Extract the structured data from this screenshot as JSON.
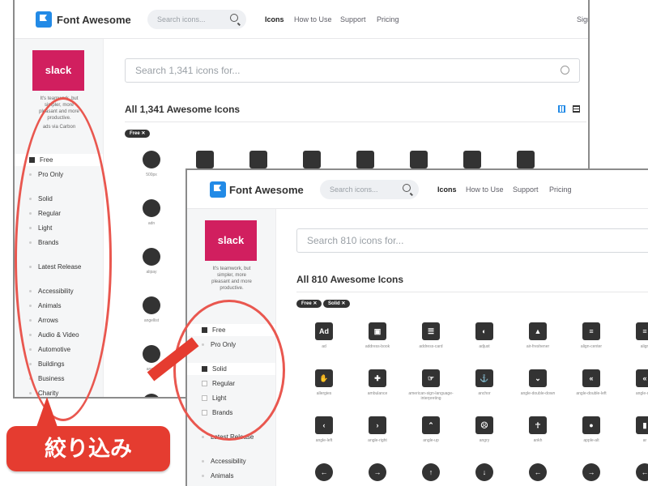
{
  "back": {
    "logo_text": "Font Awesome",
    "search_placeholder": "Search icons...",
    "nav": [
      "Icons",
      "How to Use",
      "Support",
      "Pricing"
    ],
    "signin": "Sign",
    "ad_brand": "slack",
    "ad_lines": [
      "It's teamwork, but",
      "simpler, more",
      "pleasant and more",
      "productive."
    ],
    "ad_via": "ads via Carbon",
    "big_search": "Search 1,341 icons for...",
    "heading": "All 1,341 Awesome Icons",
    "tag": "Free",
    "filters": [
      {
        "label": "Free",
        "mark": "check"
      },
      {
        "label": "Pro Only",
        "mark": "dot"
      },
      {
        "label": "Solid",
        "mark": "dot"
      },
      {
        "label": "Regular",
        "mark": "dot"
      },
      {
        "label": "Light",
        "mark": "dot"
      },
      {
        "label": "Brands",
        "mark": "dot"
      },
      {
        "label": "Latest Release",
        "mark": "dot"
      },
      {
        "label": "Accessibility",
        "mark": "dot"
      },
      {
        "label": "Animals",
        "mark": "dot"
      },
      {
        "label": "Arrows",
        "mark": "dot"
      },
      {
        "label": "Audio & Video",
        "mark": "dot"
      },
      {
        "label": "Automotive",
        "mark": "dot"
      },
      {
        "label": "Buildings",
        "mark": "dot"
      },
      {
        "label": "Business",
        "mark": "dot"
      },
      {
        "label": "Charity",
        "mark": "dot"
      }
    ],
    "icons_col1": [
      "500px",
      "adn",
      "alipay",
      "angellist",
      "angry",
      ""
    ],
    "icons_row1": [
      "",
      "",
      "",
      "",
      "",
      "",
      ""
    ]
  },
  "front": {
    "logo_text": "Font Awesome",
    "search_placeholder": "Search icons...",
    "nav": [
      "Icons",
      "How to Use",
      "Support",
      "Pricing"
    ],
    "ad_brand": "slack",
    "ad_lines": [
      "It's teamwork, but",
      "simpler, more",
      "pleasant and more",
      "productive."
    ],
    "big_search": "Search 810 icons for...",
    "heading": "All 810 Awesome Icons",
    "tags": [
      "Free",
      "Solid"
    ],
    "filters": [
      {
        "label": "Free",
        "mark": "check"
      },
      {
        "label": "Pro Only",
        "mark": "dot"
      },
      {
        "label": "Solid",
        "mark": "check"
      },
      {
        "label": "Regular",
        "mark": "box"
      },
      {
        "label": "Light",
        "mark": "box"
      },
      {
        "label": "Brands",
        "mark": "box"
      },
      {
        "label": "Latest Release",
        "mark": "dot"
      },
      {
        "label": "Accessibility",
        "mark": "dot"
      },
      {
        "label": "Animals",
        "mark": "dot"
      }
    ],
    "icons": [
      [
        "ad",
        "address-book",
        "address-card",
        "adjust",
        "air-freshener",
        "align-center",
        "align"
      ],
      [
        "allergies",
        "ambulance",
        "american-sign-language-interpreting",
        "anchor",
        "angle-double-down",
        "angle-double-left",
        "angle-dou"
      ],
      [
        "angle-left",
        "angle-right",
        "angle-up",
        "angry",
        "ankh",
        "apple-alt",
        "ar"
      ],
      [
        "",
        "",
        "",
        "",
        "",
        "",
        ""
      ]
    ],
    "glyphs": [
      [
        "Ad",
        "▣",
        "☰",
        "◐",
        "▲",
        "≡",
        "≡"
      ],
      [
        "✋",
        "✚",
        "☞",
        "⚓",
        "⌄",
        "«",
        "«"
      ],
      [
        "‹",
        "›",
        "⌃",
        "☹",
        "☥",
        "●",
        "▮"
      ],
      [
        "←",
        "→",
        "↑",
        "↓",
        "←",
        "→",
        "←"
      ]
    ]
  },
  "callout": "絞り込み"
}
